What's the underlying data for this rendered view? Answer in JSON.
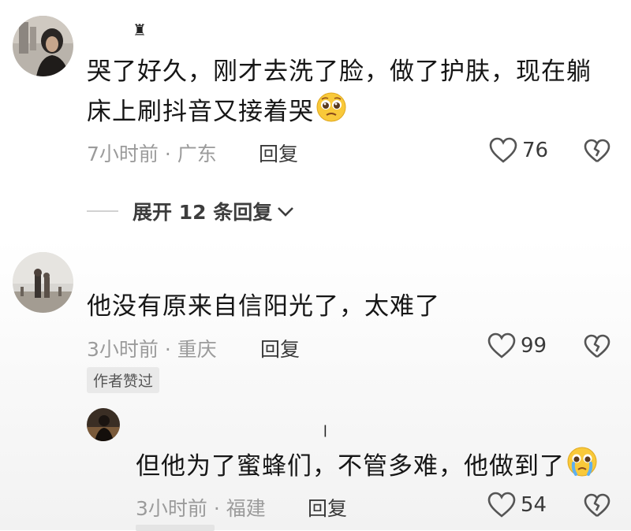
{
  "comments": [
    {
      "text_line1": "哭了好久，刚才去洗了脸，做了护肤，现在躺",
      "text_line2": "床上刷抖音又接着哭",
      "emoji": "pleading-face",
      "time": "7小时前",
      "location": "广东",
      "reply_label": "回复",
      "likes": "76",
      "expand_label": "展开 12 条回复"
    },
    {
      "text": "他没有原来自信阳光了，太难了",
      "time": "3小时前",
      "location": "重庆",
      "reply_label": "回复",
      "likes": "99",
      "badge": "作者赞过"
    },
    {
      "text": "但他为了蜜蜂们，不管多难，他做到了",
      "emoji": "crying-face",
      "time": "3小时前",
      "location": "福建",
      "reply_label": "回复",
      "likes": "54"
    }
  ],
  "meta_separator": " · "
}
